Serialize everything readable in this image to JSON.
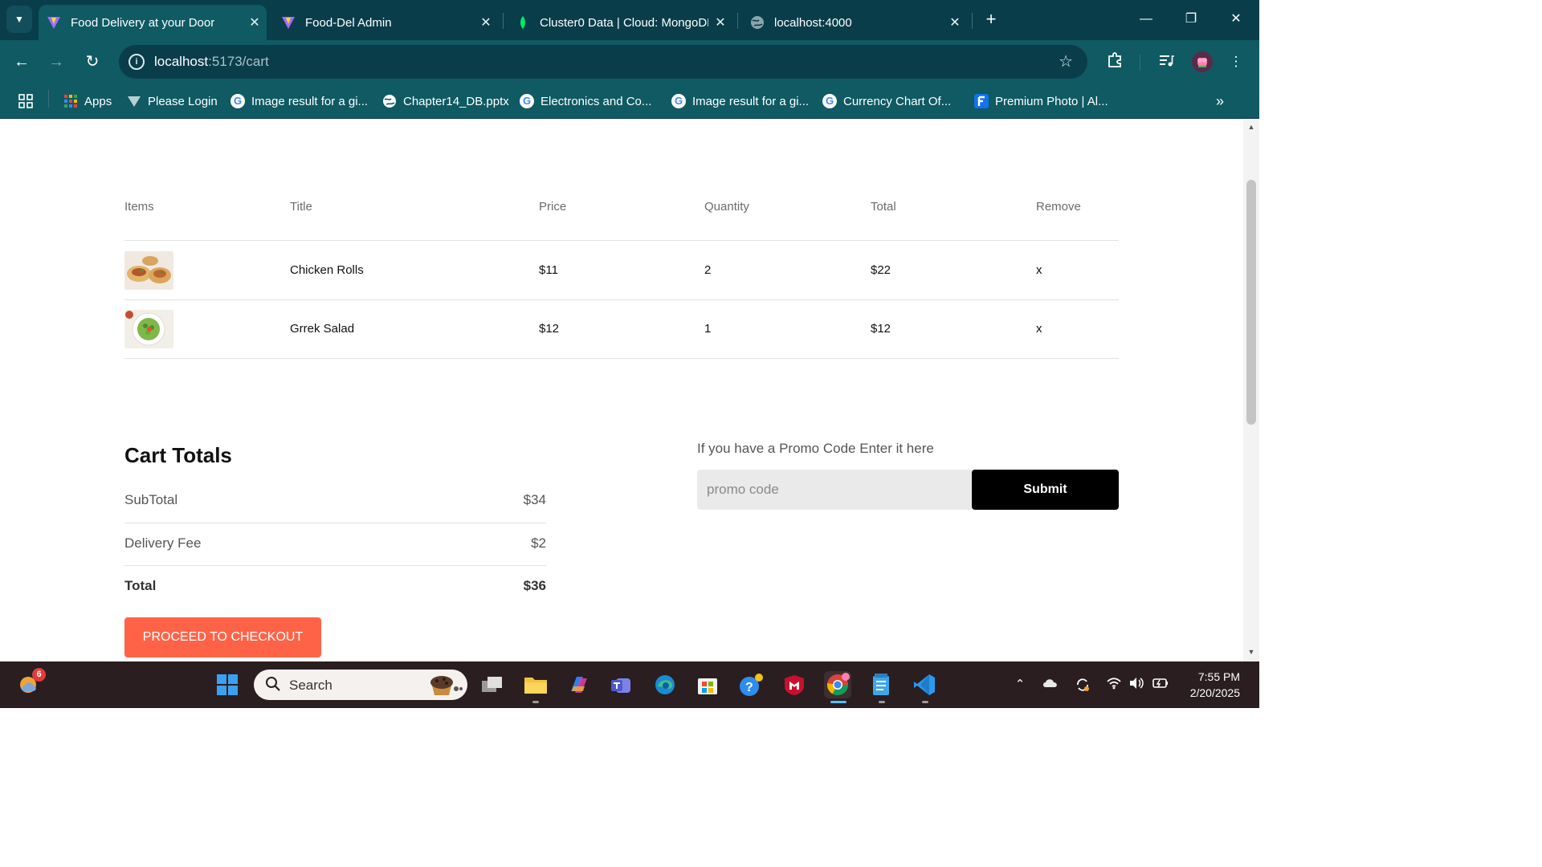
{
  "browser": {
    "tabs": [
      {
        "title": "Food Delivery at your Door",
        "icon": "vite-icon",
        "active": true
      },
      {
        "title": "Food-Del Admin",
        "icon": "vite-icon",
        "active": false
      },
      {
        "title": "Cluster0 Data | Cloud: MongoDB",
        "icon": "mongodb-leaf-icon",
        "active": false
      },
      {
        "title": "localhost:4000",
        "icon": "globe-icon",
        "active": false
      }
    ],
    "url_host": "localhost",
    "url_path": ":5173/cart",
    "bookmarks": [
      {
        "label": "Apps",
        "icon": "apps-grid-icon"
      },
      {
        "label": "Please Login",
        "icon": "vite-icon"
      },
      {
        "label": "Image result for a gi...",
        "icon": "google-icon"
      },
      {
        "label": "Chapter14_DB.pptx",
        "icon": "globe-icon"
      },
      {
        "label": "Electronics and Co...",
        "icon": "google-icon"
      },
      {
        "label": "Image result for a gi...",
        "icon": "google-icon"
      },
      {
        "label": "Currency Chart Of...",
        "icon": "google-icon"
      },
      {
        "label": "Premium Photo | Al...",
        "icon": "freepik-icon"
      }
    ],
    "colors": {
      "frame": "#0a3d4a",
      "toolbar": "#0f5a63"
    }
  },
  "cart": {
    "headers": {
      "items": "Items",
      "title": "Title",
      "price": "Price",
      "quantity": "Quantity",
      "total": "Total",
      "remove": "Remove"
    },
    "rows": [
      {
        "title": "Chicken Rolls",
        "price": "$11",
        "quantity": "2",
        "total": "$22",
        "remove": "x",
        "image": "chicken-rolls-image"
      },
      {
        "title": "Grrek Salad",
        "price": "$12",
        "quantity": "1",
        "total": "$12",
        "remove": "x",
        "image": "greek-salad-image"
      }
    ]
  },
  "totals": {
    "title": "Cart Totals",
    "subtotal_label": "SubTotal",
    "subtotal_value": "$34",
    "delivery_label": "Delivery Fee",
    "delivery_value": "$2",
    "total_label": "Total",
    "total_value": "$36",
    "checkout_label": "PROCEED TO CHECKOUT",
    "checkout_color": "#ff6347"
  },
  "promo": {
    "label": "If you have a Promo Code Enter it here",
    "placeholder": "promo code",
    "submit_label": "Submit"
  },
  "taskbar": {
    "weather_badge": "6",
    "search_placeholder": "Search",
    "time": "7:55 PM",
    "date": "2/20/2025"
  }
}
